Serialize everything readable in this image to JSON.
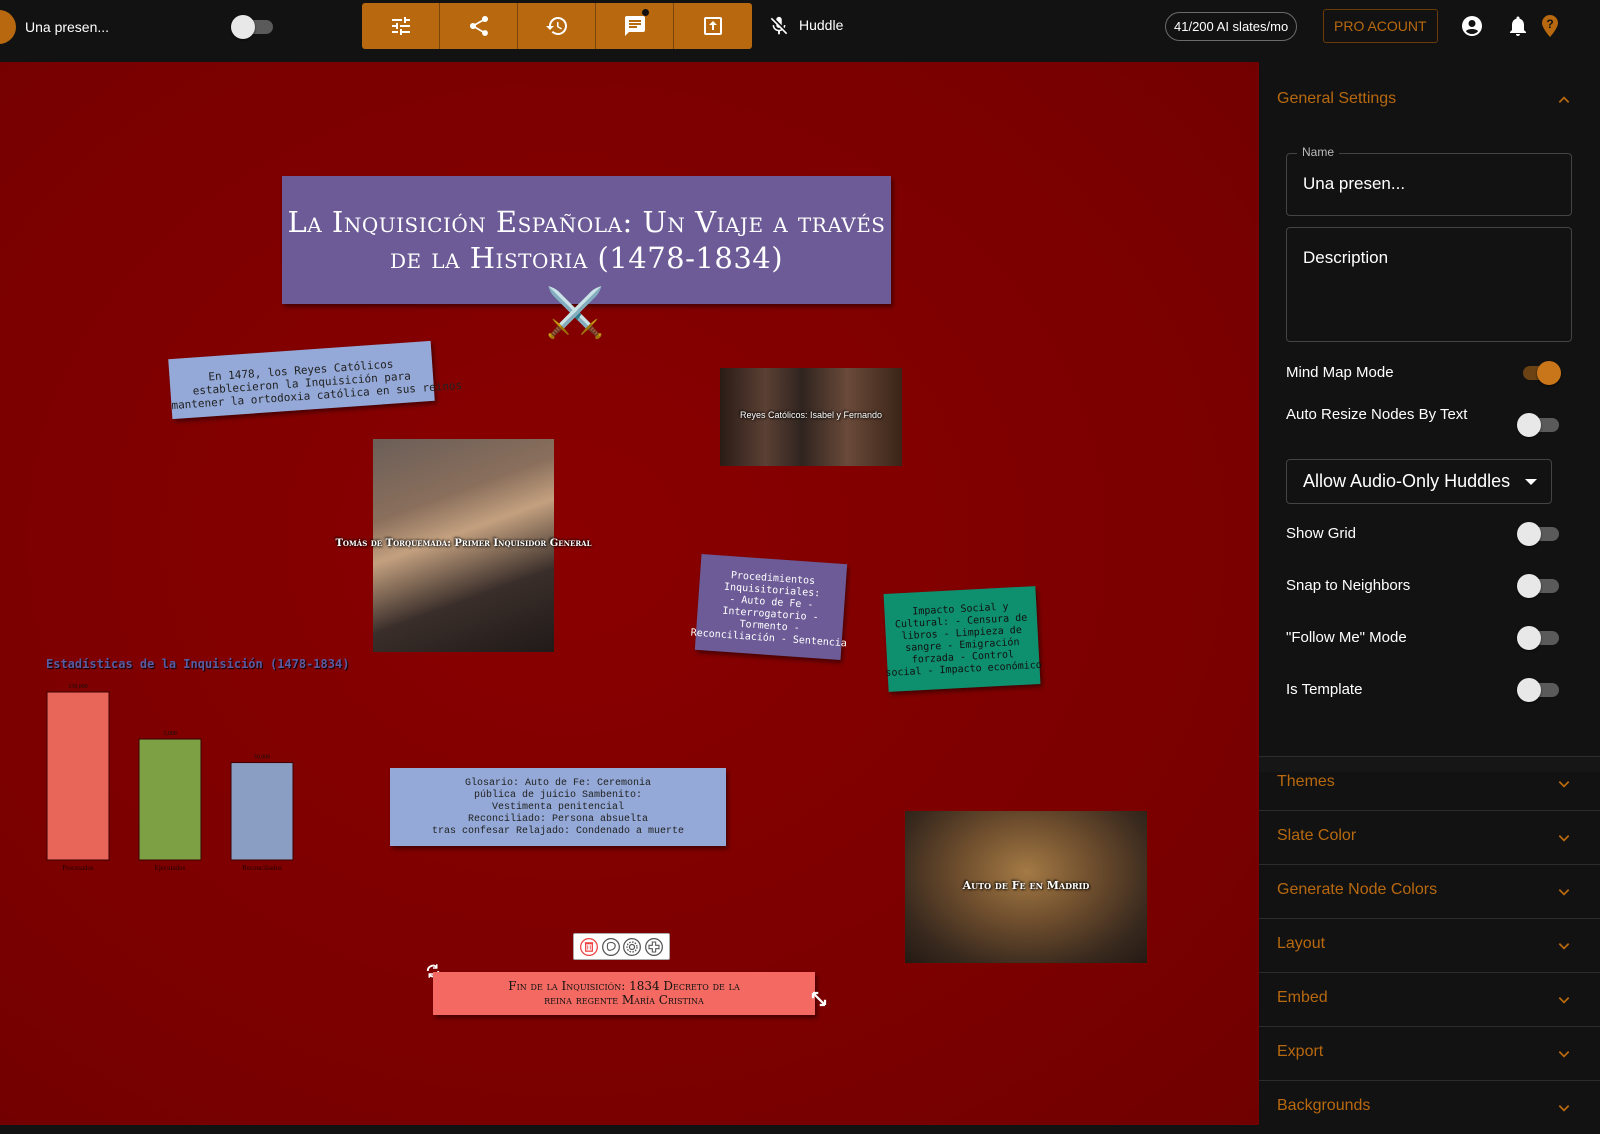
{
  "topbar": {
    "app_title": "Una presen...",
    "toolbar_buttons": [
      {
        "icon": "sliders-icon",
        "label": "Settings"
      },
      {
        "icon": "share-icon",
        "label": "Share"
      },
      {
        "icon": "history-icon",
        "label": "History"
      },
      {
        "icon": "chat-icon",
        "label": "Chat"
      },
      {
        "icon": "upload-icon",
        "label": "Present"
      }
    ],
    "huddle_label": "Huddle",
    "huddle_enabled": false,
    "ai_usage": "41/200 AI slates/mo",
    "pro_button": "PRO ACOUNT",
    "accent_color": "#b8690f"
  },
  "canvas": {
    "background_color": "#7a0000",
    "title_node": "La Inquisición Española: Un Viaje a través de la Historia (1478-1834)",
    "title_emoji": "⚔️",
    "note_1478": "En 1478, los Reyes Católicos establecieron la Inquisición para mantener la ortodoxia católica en sus reinos",
    "note_1478_lines": [
      "En 1478, los Reyes Católicos",
      "establecieron la Inquisición para",
      "mantener la ortodoxia católica en sus reinos"
    ],
    "reyes_caption": "Reyes Católicos: Isabel y Fernando",
    "torquemada_caption": "Tomás de Torquemada: Primer Inquisidor General",
    "procedimientos_lines": [
      "Procedimientos",
      "Inquisitoriales:",
      "- Auto de Fe -",
      "Interrogatorio -",
      "Tormento -",
      "Reconciliación - Sentencia"
    ],
    "impacto_lines": [
      "Impacto Social y",
      "Cultural: - Censura de",
      "libros - Limpieza de",
      "sangre - Emigración",
      "forzada - Control",
      "social - Impacto económico"
    ],
    "glosario_lines": [
      "Glosario: Auto de Fe: Ceremonia",
      "pública de juicio Sambenito:",
      "Vestimenta penitencial",
      "Reconciliado: Persona absuelta",
      "tras confesar Relajado: Condenado a muerte"
    ],
    "madrid_caption": "Auto de Fe en Madrid",
    "fin_lines": [
      "Fin de la Inquisición: 1834 Decreto de la",
      "reina regente María Cristina"
    ],
    "node_toolbar": [
      "delete-icon",
      "palette-icon",
      "settings-icon",
      "add-icon"
    ]
  },
  "chart_data": {
    "type": "bar",
    "title": "Estadísticas de la Inquisición (1478-1834)",
    "categories": [
      "Procesados",
      "Ejecutados",
      "Reconciliados"
    ],
    "values": [
      150000,
      3000,
      50000
    ],
    "value_labels": [
      "150,000",
      "3,000",
      "50,000"
    ],
    "display_heights": [
      1.0,
      0.72,
      0.58
    ],
    "colors": [
      "#e8655a",
      "#7ea045",
      "#8a9ec4"
    ],
    "xlabel": "",
    "ylabel": "",
    "grid": false,
    "legend": "none"
  },
  "sidebar": {
    "general_settings_label": "General Settings",
    "name_label": "Name",
    "name_value": "Una presen...",
    "description_placeholder": "Description",
    "settings": [
      {
        "label": "Mind Map Mode",
        "on": true
      },
      {
        "label": "Auto Resize Nodes By Text",
        "on": false
      },
      {
        "label": "Show Grid",
        "on": false
      },
      {
        "label": "Snap to Neighbors",
        "on": false
      },
      {
        "label": "\"Follow Me\" Mode",
        "on": false
      },
      {
        "label": "Is Template",
        "on": false
      }
    ],
    "huddle_select": "Allow Audio-Only Huddles",
    "sections": [
      "Themes",
      "Slate Color",
      "Generate Node Colors",
      "Layout",
      "Embed",
      "Export",
      "Backgrounds"
    ]
  }
}
